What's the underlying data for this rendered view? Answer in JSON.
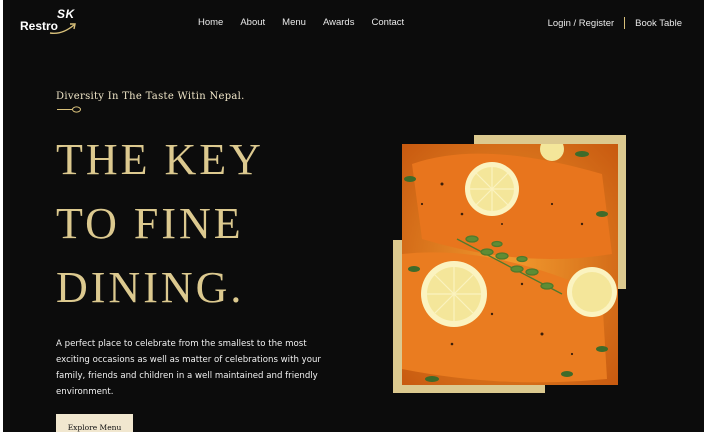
{
  "brand": {
    "mark": "SK",
    "name": "Restro"
  },
  "nav": {
    "links": [
      "Home",
      "About",
      "Menu",
      "Awards",
      "Contact"
    ],
    "login": "Login / Register",
    "book": "Book Table"
  },
  "hero": {
    "tagline": "Diversity In The Taste Witin Nepal.",
    "headline": [
      "THE KEY",
      "TO FINE",
      "DINING."
    ],
    "description": "A perfect place to celebrate from the smallest to the most exciting occasions as well as matter of celebrations with your family, friends and children in a well maintained and friendly environment.",
    "cta": "Explore Menu"
  },
  "colors": {
    "background": "#0c0c0c",
    "gold": "#dcc98f",
    "button": "#f1e7cf"
  },
  "icons": [
    "logo-swoosh-icon",
    "spoon-icon"
  ]
}
